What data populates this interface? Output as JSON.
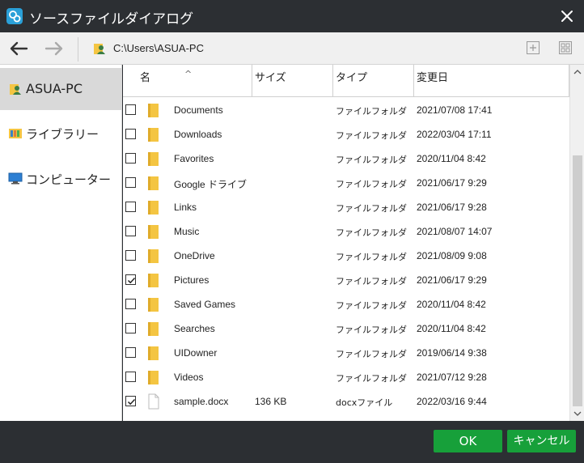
{
  "window": {
    "title": "ソースファイルダイアログ"
  },
  "toolbar": {
    "path": "C:\\Users\\ASUA-PC"
  },
  "sidebar": {
    "items": [
      {
        "label": "ASUA-PC",
        "icon": "user-folder-icon",
        "selected": true
      },
      {
        "label": "ライブラリー",
        "icon": "library-icon",
        "selected": false
      },
      {
        "label": "コンピューター",
        "icon": "computer-icon",
        "selected": false
      }
    ]
  },
  "columns": {
    "name": "名",
    "size": "サイズ",
    "type": "タイプ",
    "modified": "変更日"
  },
  "files": [
    {
      "name": "Documents",
      "size": "",
      "type": "ファイルフォルダ",
      "modified": "2021/07/08 17:41",
      "checked": false,
      "kind": "folder"
    },
    {
      "name": "Downloads",
      "size": "",
      "type": "ファイルフォルダ",
      "modified": "2022/03/04 17:11",
      "checked": false,
      "kind": "folder"
    },
    {
      "name": "Favorites",
      "size": "",
      "type": "ファイルフォルダ",
      "modified": "2020/11/04 8:42",
      "checked": false,
      "kind": "folder"
    },
    {
      "name": "Google ドライブ",
      "size": "",
      "type": "ファイルフォルダ",
      "modified": "2021/06/17 9:29",
      "checked": false,
      "kind": "folder"
    },
    {
      "name": "Links",
      "size": "",
      "type": "ファイルフォルダ",
      "modified": "2021/06/17 9:28",
      "checked": false,
      "kind": "folder"
    },
    {
      "name": "Music",
      "size": "",
      "type": "ファイルフォルダ",
      "modified": "2021/08/07 14:07",
      "checked": false,
      "kind": "folder"
    },
    {
      "name": "OneDrive",
      "size": "",
      "type": "ファイルフォルダ",
      "modified": "2021/08/09 9:08",
      "checked": false,
      "kind": "folder"
    },
    {
      "name": "Pictures",
      "size": "",
      "type": "ファイルフォルダ",
      "modified": "2021/06/17 9:29",
      "checked": true,
      "kind": "folder"
    },
    {
      "name": "Saved Games",
      "size": "",
      "type": "ファイルフォルダ",
      "modified": "2020/11/04 8:42",
      "checked": false,
      "kind": "folder"
    },
    {
      "name": "Searches",
      "size": "",
      "type": "ファイルフォルダ",
      "modified": "2020/11/04 8:42",
      "checked": false,
      "kind": "folder"
    },
    {
      "name": "UIDowner",
      "size": "",
      "type": "ファイルフォルダ",
      "modified": "2019/06/14 9:38",
      "checked": false,
      "kind": "folder"
    },
    {
      "name": "Videos",
      "size": "",
      "type": "ファイルフォルダ",
      "modified": "2021/07/12 9:28",
      "checked": false,
      "kind": "folder"
    },
    {
      "name": "sample.docx",
      "size": "136 KB",
      "type": "docxファイル",
      "modified": "2022/03/16 9:44",
      "checked": true,
      "kind": "file"
    }
  ],
  "footer": {
    "ok_label": "OK",
    "cancel_label": "キャンセル"
  },
  "colors": {
    "accent": "#17a03a",
    "titlebar": "#2c2f33",
    "folder": "#f4c542",
    "selected": "#d9d9d9"
  }
}
